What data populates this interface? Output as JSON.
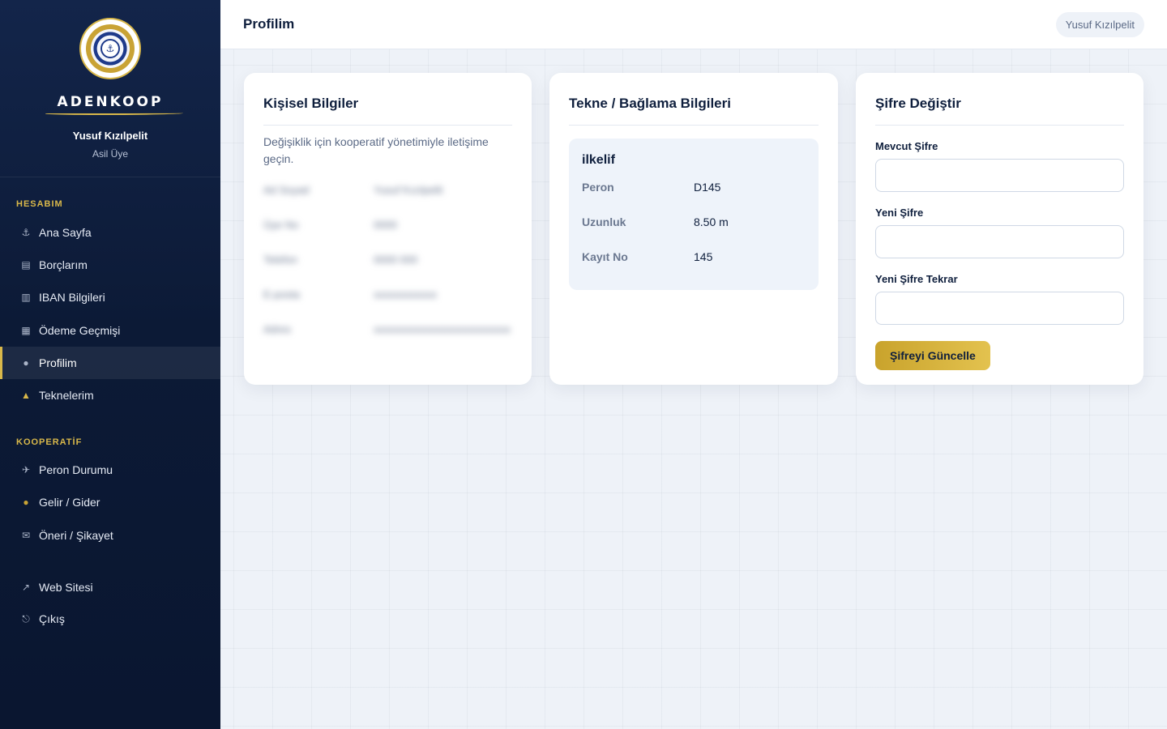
{
  "sidebar": {
    "brand": "ADENKOOP",
    "logo_icon": "anchor-seal-logo",
    "user_name": "Yusuf Kızılpelit",
    "user_role": "Asil Üye",
    "sections": {
      "account": "HESABIM",
      "coop": "KOOPERATİF"
    },
    "items": [
      {
        "label": "Ana Sayfa",
        "icon": "anchor-icon",
        "glyph": "⚓"
      },
      {
        "label": "Borçlarım",
        "icon": "clipboard-icon",
        "glyph": "▤"
      },
      {
        "label": "IBAN Bilgileri",
        "icon": "bank-icon",
        "glyph": "▥"
      },
      {
        "label": "Ödeme Geçmişi",
        "icon": "receipt-icon",
        "glyph": "▦"
      },
      {
        "label": "Profilim",
        "icon": "user-icon",
        "glyph": "●",
        "active": true
      },
      {
        "label": "Teknelerim",
        "icon": "sailboat-icon",
        "glyph": "▲"
      },
      {
        "label": "Peron Durumu",
        "icon": "map-icon",
        "glyph": "✈"
      },
      {
        "label": "Gelir / Gider",
        "icon": "money-bag-icon",
        "glyph": "●"
      },
      {
        "label": "Öneri / Şikayet",
        "icon": "mail-icon",
        "glyph": "✉"
      },
      {
        "label": "Web Sitesi",
        "icon": "external-link-icon",
        "glyph": "↗"
      },
      {
        "label": "Çıkış",
        "icon": "logout-icon",
        "glyph": "⎋"
      }
    ],
    "accent_color": "#d9b84a"
  },
  "topbar": {
    "title": "Profilim",
    "user_chip": "Yusuf Kızılpelit"
  },
  "personal": {
    "title": "Kişisel Bilgiler",
    "hint": "Değişiklik için kooperatif yönetimiyle iletişime geçin.",
    "rows": [
      {
        "label": "Ad Soyad",
        "value": "Yusuf Kızılpelit"
      },
      {
        "label": "Üye No",
        "value": "0000"
      },
      {
        "label": "Telefon",
        "value": "0000 000"
      },
      {
        "label": "E-posta",
        "value": "xxxxxxxxxxxx"
      },
      {
        "label": "Adres",
        "value": "xxxxxxxxxxxxxxxxxxxxxxxxxx"
      }
    ]
  },
  "boat": {
    "title": "Tekne / Bağlama Bilgileri",
    "name": "ilkelif",
    "rows": [
      {
        "label": "Peron",
        "value": "D145"
      },
      {
        "label": "Uzunluk",
        "value": "8.50 m"
      },
      {
        "label": "Kayıt No",
        "value": "145"
      }
    ]
  },
  "password": {
    "title": "Şifre Değiştir",
    "current_label": "Mevcut Şifre",
    "new_label": "Yeni Şifre",
    "repeat_label": "Yeni Şifre Tekrar",
    "current_value": "",
    "new_value": "",
    "repeat_value": "",
    "submit_label": "Şifreyi Güncelle",
    "button_color": "#d4b23c"
  }
}
